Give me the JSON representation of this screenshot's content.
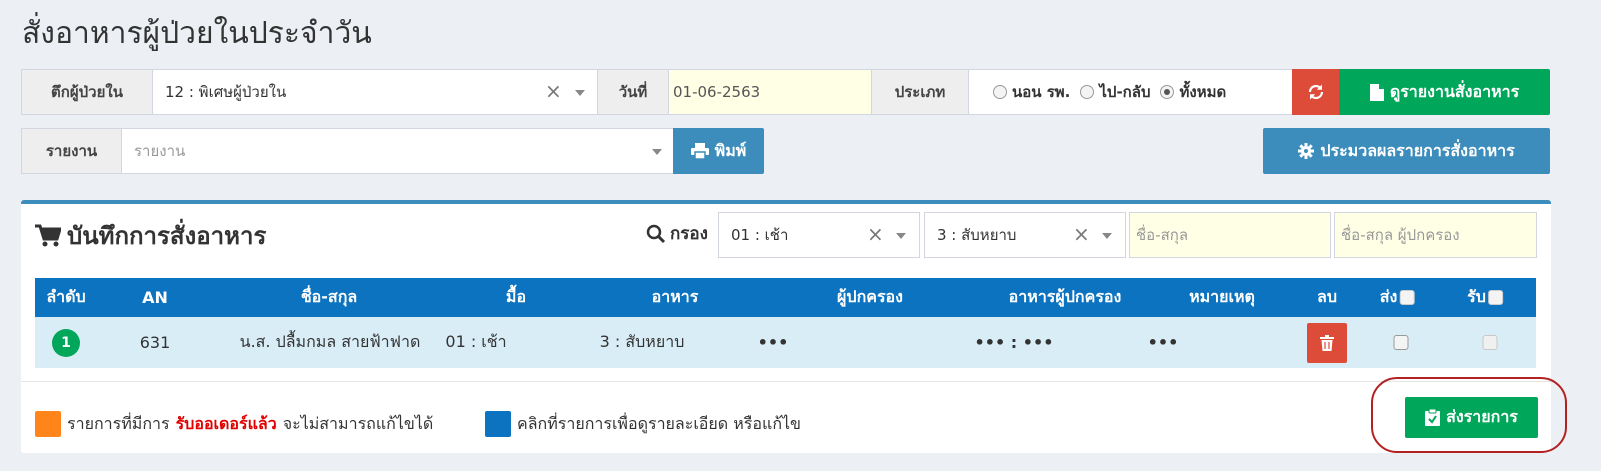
{
  "page": {
    "title": "สั่งอาหารผู้ป่วยในประจำวัน"
  },
  "top_form": {
    "ward_label": "ตึกผู้ป่วยใน",
    "ward_value": "12 : พิเศษผู้ป่วยใน",
    "date_label": "วันที่",
    "date_value": "01-06-2563",
    "type_label": "ประเภท",
    "type_options": [
      "นอน รพ.",
      "ไป-กลับ",
      "ทั้งหมด"
    ],
    "type_selected": "ทั้งหมด",
    "refresh_icon": "refresh-icon",
    "report_view_button": "ดูรายงานสั่งอาหาร",
    "report_label": "รายงาน",
    "report_placeholder": "รายงาน",
    "print_button": "พิมพ์",
    "process_button": "ประมวลผลรายการสั่งอาหาร"
  },
  "panel": {
    "title": "บันทึกการสั่งอาหาร",
    "filter_label": "กรอง",
    "meal_filter": "01 : เช้า",
    "food_filter": "3 : สับหยาบ",
    "name_placeholder": "ชื่อ-สกุล",
    "guardian_placeholder": "ชื่อ-สกุล ผู้ปกครอง"
  },
  "table": {
    "columns": [
      "ลำดับ",
      "AN",
      "ชื่อ-สกุล",
      "มื้อ",
      "อาหาร",
      "ผู้ปกครอง",
      "อาหารผู้ปกครอง",
      "หมายเหตุ",
      "ลบ",
      "ส่ง",
      "รับ"
    ],
    "rows": [
      {
        "no": "1",
        "an": "631",
        "name": "น.ส. ปลื้มกมล สายฟ้าฟาด",
        "meal": "01 : เช้า",
        "food": "3 : สับหยาบ",
        "guardian": "•••",
        "guardian_food": "••• : •••",
        "note": "•••",
        "send_checked": false,
        "receive_checked": false
      }
    ]
  },
  "legend": {
    "orange_text_before": "รายการที่มีการ",
    "orange_text_red": "รับออเดอร์แล้ว",
    "orange_text_after": "จะไม่สามารถแก้ไขได้",
    "blue_text": "คลิกที่รายการเพื่อดูรายละเอียด หรือแก้ไข",
    "orange_color": "#ff851b",
    "blue_color": "#0b73bf"
  },
  "submit_button": "ส่งรายการ",
  "colors": {
    "green": "#00a65a",
    "red": "#dd4b39",
    "blue": "#3c8dbc",
    "header_blue": "#0b73bf",
    "row_bg": "#d9edf7",
    "highlight_circle": "#b22222"
  }
}
